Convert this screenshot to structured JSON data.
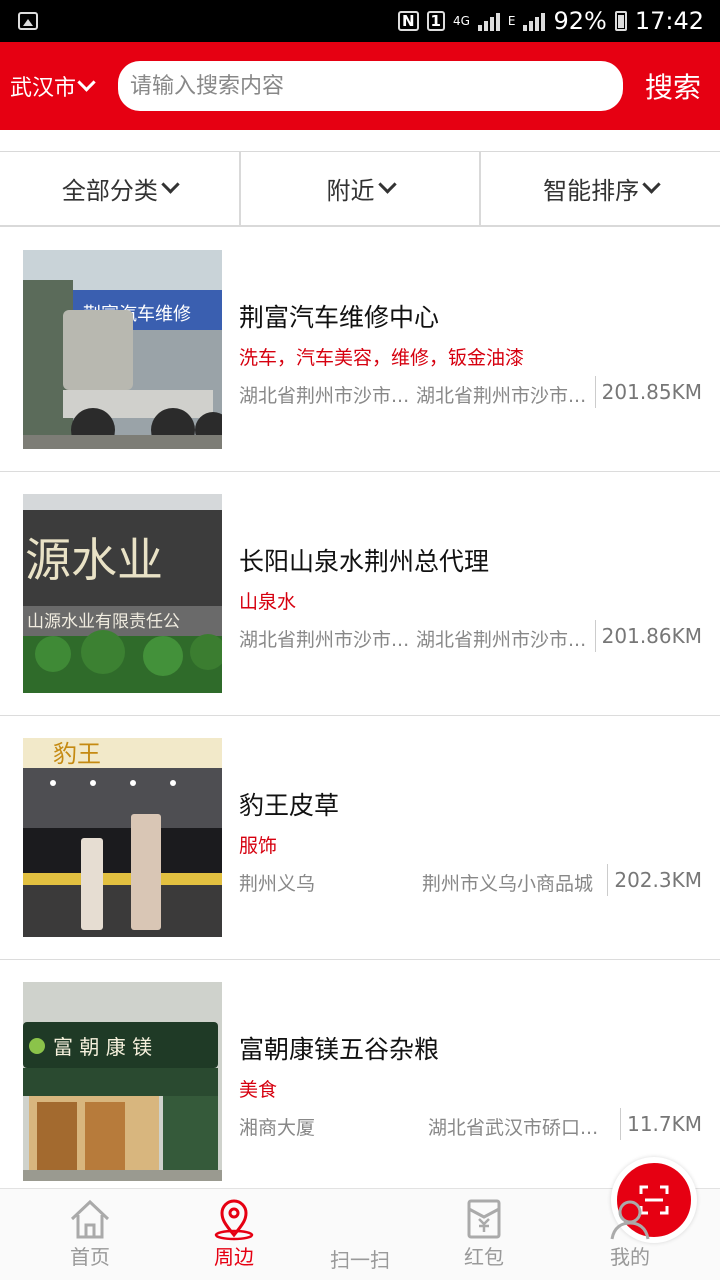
{
  "status_bar": {
    "sim_label": "1",
    "network_4g": "4G",
    "network_e": "E",
    "battery": "92%",
    "time": "17:42"
  },
  "header": {
    "city": "武汉市",
    "search_placeholder": "请输入搜索内容",
    "search_button": "搜索"
  },
  "filters": [
    {
      "label": "全部分类"
    },
    {
      "label": "附近"
    },
    {
      "label": "智能排序"
    }
  ],
  "shops": [
    {
      "name": "荆富汽车维修中心",
      "tags": "洗车，汽车美容，维修，钣金油漆",
      "address_short": "湖北省荆州市沙市...",
      "address_full": "湖北省荆州市沙市...",
      "distance": "201.85KM",
      "sign_text": "荆富汽车维修"
    },
    {
      "name": "长阳山泉水荆州总代理",
      "tags": "山泉水",
      "address_short": "湖北省荆州市沙市...",
      "address_full": "湖北省荆州市沙市...",
      "distance": "201.86KM",
      "sign_text": "源水业",
      "sign_subtext": "山源水业有限责任公"
    },
    {
      "name": "豹王皮草",
      "tags": "服饰",
      "address_short": "荆州义乌",
      "address_full": "荆州市义乌小商品城",
      "distance": "202.3KM",
      "sign_text": "豹王"
    },
    {
      "name": "富朝康镁五谷杂粮",
      "tags": "美食",
      "address_short": "湘商大厦",
      "address_full": "湖北省武汉市硚口...",
      "distance": "11.7KM",
      "sign_text": "富 朝 康 镁"
    }
  ],
  "tabs": [
    {
      "label": "首页",
      "icon": "home-icon"
    },
    {
      "label": "周边",
      "icon": "location-pin-icon"
    },
    {
      "label": "扫一扫",
      "icon": "scan-icon"
    },
    {
      "label": "红包",
      "icon": "red-envelope-icon"
    },
    {
      "label": "我的",
      "icon": "user-icon"
    }
  ],
  "colors": {
    "brand_red": "#e60012",
    "tag_red": "#d6000f",
    "inactive_tab": "#999999"
  }
}
